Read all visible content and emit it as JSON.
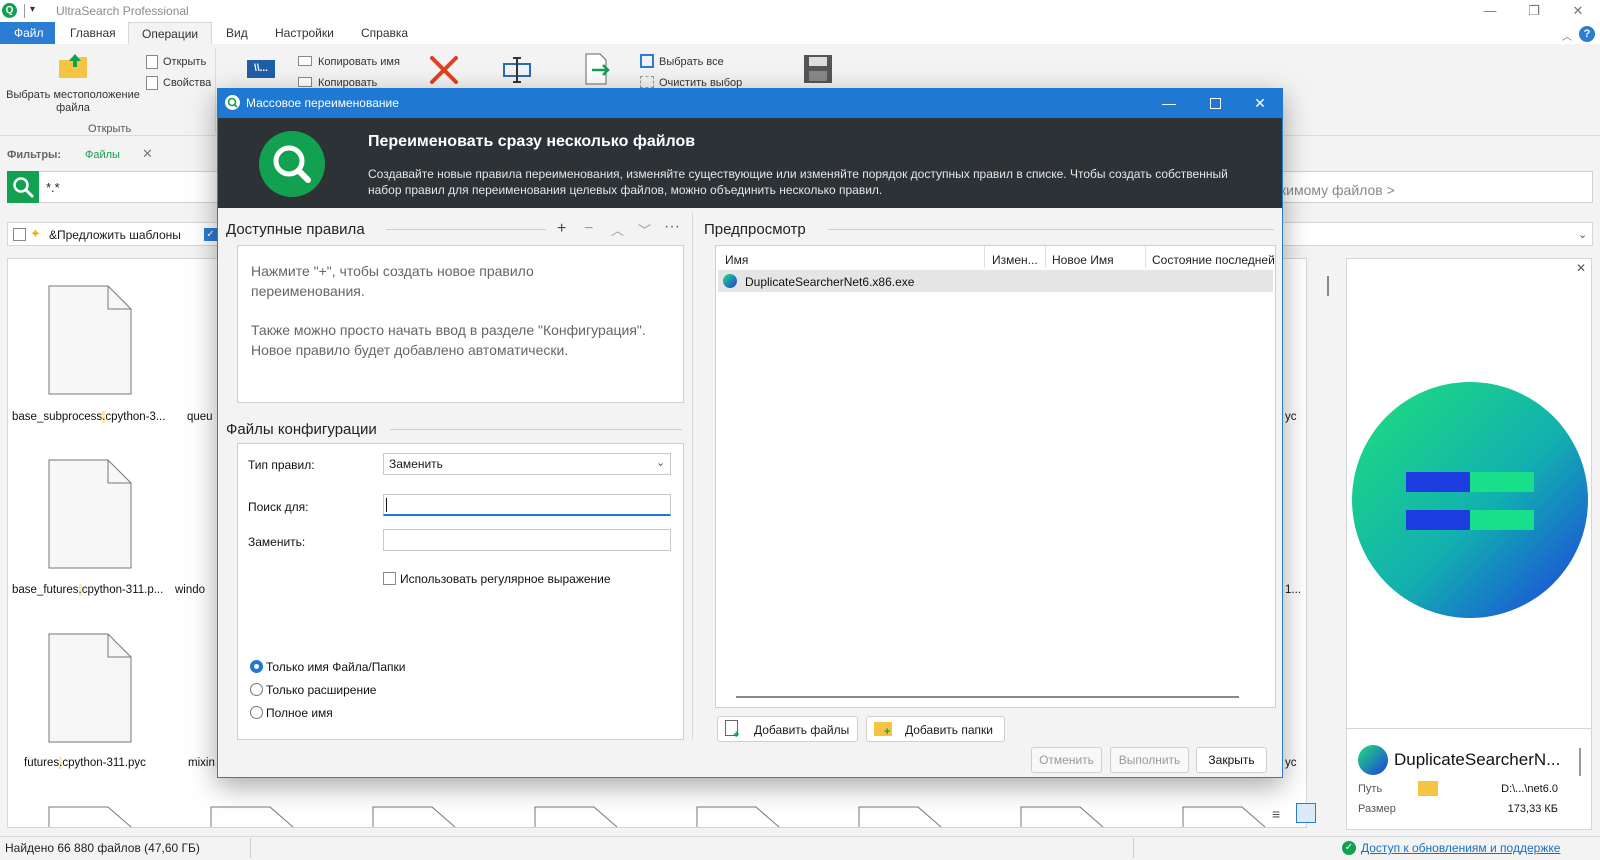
{
  "window": {
    "title": "UltraSearch Professional",
    "minimize": "—",
    "maximize": "❐",
    "close": "✕",
    "help": "?"
  },
  "menu": {
    "tabs": [
      "Файл",
      "Главная",
      "Операции",
      "Вид",
      "Настройки",
      "Справка"
    ]
  },
  "ribbon": {
    "choose_location": "Выбрать местоположение файла",
    "open": "Открыть",
    "properties": "Свойства",
    "group_open": "Открыть",
    "copy_name": "Копировать имя",
    "copy": "Копировать",
    "select_all": "Выбрать все",
    "clear_selection": "Очистить выбор"
  },
  "filters": {
    "label": "Фильтры:",
    "value": "Файлы"
  },
  "search": {
    "query": "*.*",
    "hint_fragment": "кимому файлов >"
  },
  "row2": {
    "suggest_templates": "&Предложить шаблоны"
  },
  "grid": {
    "files": [
      {
        "pre": "base_subprocess",
        "hl": ".",
        "post": "cpython-3..."
      },
      {
        "pre": "base_futures",
        "hl": ".",
        "post": "cpython-311.p..."
      },
      {
        "pre": "futures",
        "hl": ".",
        "post": "cpython-311.pyc"
      }
    ],
    "col2": [
      "queu",
      "windo",
      "mixin"
    ],
    "right_edge": [
      "yc",
      "1...",
      "yc"
    ]
  },
  "preview_panel": {
    "name": "DuplicateSearcherN...",
    "path_label": "Путь",
    "path_value": "D:\\...\\net6.0",
    "size_label": "Размер",
    "size_value": "173,33 КБ"
  },
  "status": {
    "found": "Найдено 66 880 файлов (47,60 ГБ)",
    "update_link": "Доступ к обновлениям и поддержке"
  },
  "dialog": {
    "title": "Массовое переименование",
    "banner_title": "Переименовать сразу несколько файлов",
    "banner_desc": "Создавайте новые правила переименования, изменяйте существующие или изменяйте порядок доступных правил в списке. Чтобы создать собственный набор правил для переименования целевых файлов, можно объединить несколько правил.",
    "rules_title": "Доступные правила",
    "rules_hint_1": "Нажмите \"+\", чтобы создать новое правило переименования.",
    "rules_hint_2": "Также можно просто начать ввод в разделе \"Конфигурация\". Новое правило будет добавлено автоматически.",
    "config_title": "Файлы конфигурации",
    "rule_type_label": "Тип правил:",
    "rule_type_value": "Заменить",
    "search_label": "Поиск для:",
    "search_value": "",
    "replace_label": "Заменить:",
    "replace_value": "",
    "regex_label": "Использовать регулярное выражение",
    "radio_options": [
      "Только имя Файла/Папки",
      "Только расширение",
      "Полное имя"
    ],
    "preview_title": "Предпросмотр",
    "columns": [
      "Имя",
      "Измен...",
      "Новое Имя",
      "Состояние последней"
    ],
    "rows": [
      {
        "name": "DuplicateSearcherNet6.x86.exe"
      }
    ],
    "add_files": "Добавить файлы",
    "add_folders": "Добавить папки",
    "cancel": "Отменить",
    "execute": "Выполнить",
    "close": "Закрыть"
  }
}
